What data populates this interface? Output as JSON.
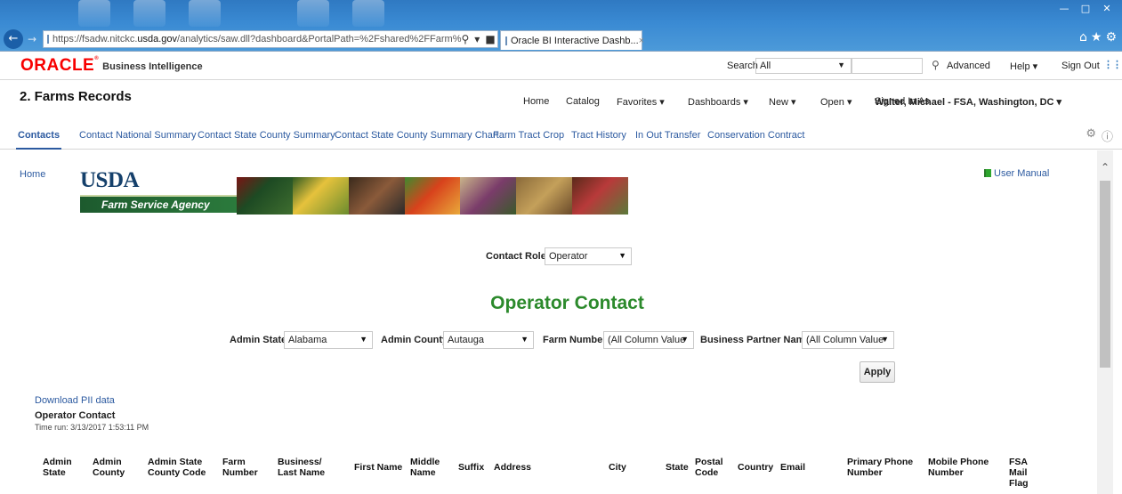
{
  "browser": {
    "url_prefix": "https://fsadw.nitckc.",
    "url_domain": "usda.gov",
    "url_suffix": "/analytics/saw.dll?dashboard&PortalPath=%2Fshared%2FFarm%",
    "tab_title": "Oracle BI Interactive Dashb...",
    "tab_close": "×"
  },
  "header": {
    "logo": "ORACLE",
    "product": "Business Intelligence",
    "search_label": "Search",
    "search_scope": "All",
    "advanced": "Advanced",
    "help": "Help ▾",
    "sign_out": "Sign Out"
  },
  "dashboard": {
    "title": "2. Farms Records",
    "nav": {
      "home": "Home",
      "catalog": "Catalog",
      "favorites": "Favorites ▾",
      "dashboards": "Dashboards ▾",
      "new": "New ▾",
      "open": "Open ▾",
      "signed_in_as": "Signed In As",
      "user": "Walter, Michael - FSA, Washington, DC ▾"
    },
    "tabs": [
      "Contacts",
      "Contact National Summary",
      "Contact State County Summary",
      "Contact State County Summary Chart",
      "Farm Tract Crop",
      "Tract History",
      "In Out Transfer",
      "Conservation Contract"
    ]
  },
  "content": {
    "home_link": "Home",
    "usda": "USDA",
    "agency": "Farm Service Agency",
    "user_manual": "User Manual",
    "contact_role_label": "Contact Role",
    "contact_role_value": "Operator",
    "report_heading": "Operator Contact",
    "prompts": {
      "admin_state_label": "Admin State",
      "admin_state_value": "Alabama",
      "admin_county_label": "Admin County",
      "admin_county_value": "Autauga",
      "farm_number_label": "Farm Number",
      "farm_number_value": "(All Column Value",
      "bp_name_label": "Business Partner Name",
      "bp_name_value": "(All Column Value"
    },
    "apply": "Apply",
    "download_link": "Download PII data",
    "report_title": "Operator Contact",
    "time_run": "Time run: 3/13/2017 1:53:11 PM",
    "columns": [
      "Admin State",
      "Admin County",
      "Admin State County Code",
      "Farm Number",
      "Business/ Last Name",
      "First Name",
      "Middle Name",
      "Suffix",
      "Address",
      "City",
      "State",
      "Postal Code",
      "Country",
      "Email",
      "Primary Phone Number",
      "Mobile Phone Number",
      "FSA Mail Flag"
    ]
  },
  "colors": {
    "oracle_red": "#f80000",
    "link_blue": "#2c5aa0",
    "heading_green": "#2c8a2c",
    "browser_blue": "#3a8ad3"
  }
}
